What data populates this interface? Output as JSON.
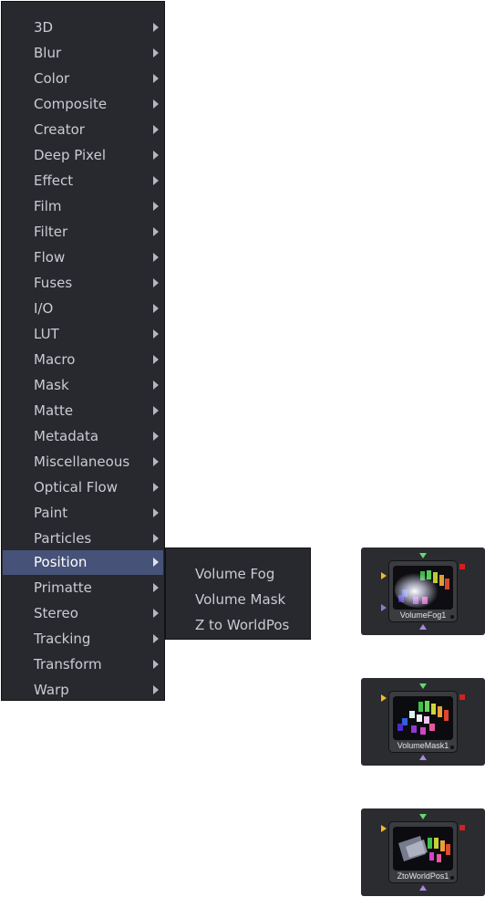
{
  "menu": {
    "items": [
      {
        "label": "3D"
      },
      {
        "label": "Blur"
      },
      {
        "label": "Color"
      },
      {
        "label": "Composite"
      },
      {
        "label": "Creator"
      },
      {
        "label": "Deep Pixel"
      },
      {
        "label": "Effect"
      },
      {
        "label": "Film"
      },
      {
        "label": "Filter"
      },
      {
        "label": "Flow"
      },
      {
        "label": "Fuses"
      },
      {
        "label": "I/O"
      },
      {
        "label": "LUT"
      },
      {
        "label": "Macro"
      },
      {
        "label": "Mask"
      },
      {
        "label": "Matte"
      },
      {
        "label": "Metadata"
      },
      {
        "label": "Miscellaneous"
      },
      {
        "label": "Optical Flow"
      },
      {
        "label": "Paint"
      },
      {
        "label": "Particles"
      },
      {
        "label": "Position"
      },
      {
        "label": "Primatte"
      },
      {
        "label": "Stereo"
      },
      {
        "label": "Tracking"
      },
      {
        "label": "Transform"
      },
      {
        "label": "Warp"
      }
    ],
    "active_item": "Position"
  },
  "submenu": {
    "items": [
      {
        "label": "Volume Fog"
      },
      {
        "label": "Volume Mask"
      },
      {
        "label": "Z to WorldPos"
      }
    ]
  },
  "nodes": [
    {
      "name": "VolumeFog1",
      "icon": "volume-fog-thumbnail"
    },
    {
      "name": "VolumeMask1",
      "icon": "volume-mask-thumbnail"
    },
    {
      "name": "ZtoWorldPos1",
      "icon": "z-to-worldpos-thumbnail"
    }
  ],
  "colors": {
    "menu_bg": "#27292e",
    "menu_highlight": "#465277",
    "node_bg": "#3b3c40",
    "input_yellow": "#f0b928",
    "input_green": "#67d76f",
    "input_purple": "#a987e4",
    "output_red": "#d12020"
  }
}
